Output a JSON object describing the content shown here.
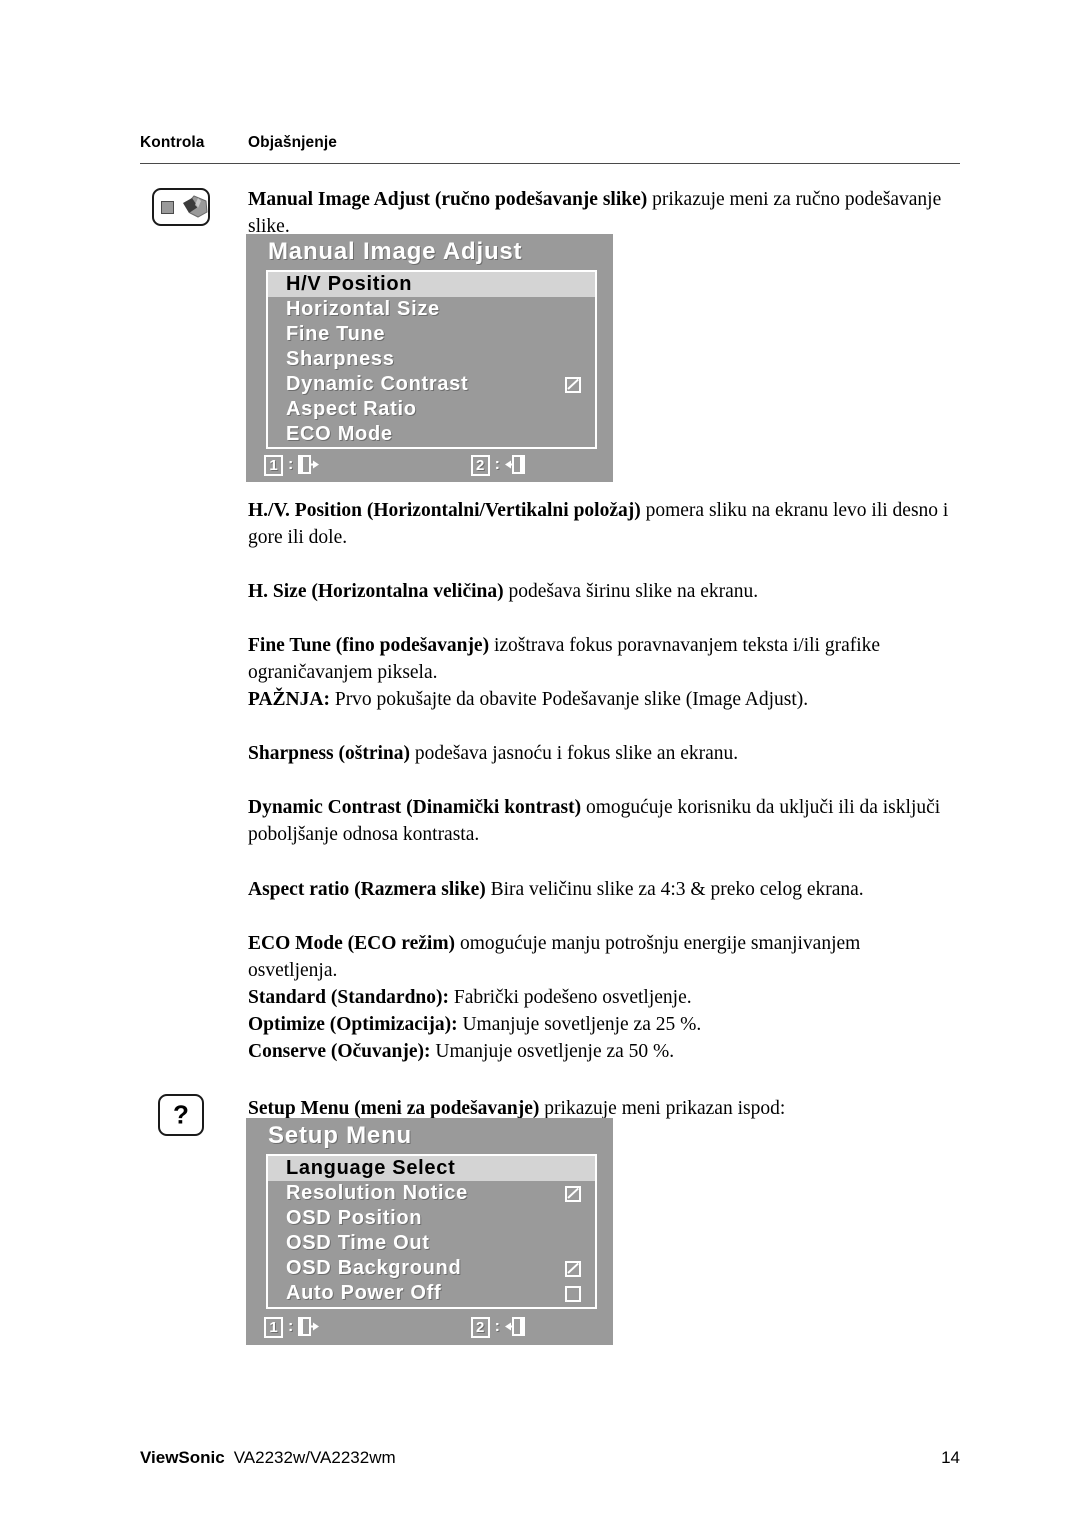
{
  "columns": {
    "control_header": "Kontrola",
    "explanation_header": "Objašnjenje"
  },
  "sections": {
    "manual_image_adjust": {
      "icon": "image-adjust-icon",
      "intro_bold": "Manual Image Adjust (ručno podešavanje slike)",
      "intro_rest": " prikazuje meni za ručno podešavanje slike.",
      "osd": {
        "title": "Manual Image Adjust",
        "rows": [
          {
            "label": "H/V Position",
            "selected": true,
            "checkbox": "none"
          },
          {
            "label": "Horizontal Size",
            "selected": false,
            "checkbox": "none"
          },
          {
            "label": "Fine Tune",
            "selected": false,
            "checkbox": "none"
          },
          {
            "label": "Sharpness",
            "selected": false,
            "checkbox": "none"
          },
          {
            "label": "Dynamic Contrast",
            "selected": false,
            "checkbox": "checked"
          },
          {
            "label": "Aspect Ratio",
            "selected": false,
            "checkbox": "none"
          },
          {
            "label": "ECO Mode",
            "selected": false,
            "checkbox": "none"
          }
        ],
        "footer": {
          "key1": "1",
          "sep1": ":",
          "icon1": "exit-right-icon",
          "key2": "2",
          "sep2": ":",
          "icon2": "exit-left-icon"
        }
      }
    },
    "setup_menu": {
      "icon": "question-mark-icon",
      "icon_glyph": "?",
      "intro_bold": "Setup Menu (meni za podešavanje)",
      "intro_rest": " prikazuje meni prikazan ispod:",
      "osd": {
        "title": "Setup Menu",
        "rows": [
          {
            "label": "Language Select",
            "selected": true,
            "checkbox": "none"
          },
          {
            "label": "Resolution Notice",
            "selected": false,
            "checkbox": "checked"
          },
          {
            "label": "OSD Position",
            "selected": false,
            "checkbox": "none"
          },
          {
            "label": "OSD Time Out",
            "selected": false,
            "checkbox": "none"
          },
          {
            "label": "OSD Background",
            "selected": false,
            "checkbox": "checked"
          },
          {
            "label": "Auto Power Off",
            "selected": false,
            "checkbox": "empty"
          }
        ],
        "footer": {
          "key1": "1",
          "sep1": ":",
          "icon1": "exit-right-icon",
          "key2": "2",
          "sep2": ":",
          "icon2": "exit-left-icon"
        }
      }
    }
  },
  "paragraphs": [
    {
      "id": "hv-position",
      "bold": "H./V. Position (Horizontalni/Vertikalni položaj)",
      "rest": " pomera sliku na ekranu levo ili desno i gore ili dole."
    },
    {
      "id": "h-size",
      "bold": "H. Size (Horizontalna veličina)",
      "rest": " podešava širinu slike na ekranu."
    },
    {
      "id": "fine-tune",
      "bold": "Fine Tune (fino podešavanje)",
      "rest": " izoštrava fokus poravnavanjem teksta i/ili grafike ograničavanjem piksela.",
      "note_bold": "PAŽNJA:",
      "note_rest": " Prvo pokušajte da obavite Podešavanje slike (Image Adjust)."
    },
    {
      "id": "sharpness",
      "bold": "Sharpness (oštrina)",
      "rest": " podešava jasnoću i fokus slike an ekranu."
    },
    {
      "id": "dynamic-contrast",
      "bold": "Dynamic Contrast (Dinamički kontrast)",
      "rest": " omogućuje korisniku da uključi ili da isključi poboljšanje odnosa kontrasta."
    },
    {
      "id": "aspect-ratio",
      "bold": "Aspect ratio (Razmera slike)",
      "rest": " Bira veličinu slike za 4:3 & preko celog ekrana."
    },
    {
      "id": "eco-mode",
      "bold": "ECO Mode (ECO režim)",
      "rest": " omogućuje manju potrošnju energije smanjivanjem osvetljenja.",
      "sub": [
        {
          "bold": "Standard (Standardno):",
          "rest": " Fabrički podešeno osvetljenje."
        },
        {
          "bold": "Optimize (Optimizacija):",
          "rest": " Umanjuje sovetljenje za 25 %."
        },
        {
          "bold": "Conserve (Očuvanje):",
          "rest": " Umanjuje osvetljenje za 50 %."
        }
      ]
    }
  ],
  "footer": {
    "brand": "ViewSonic",
    "model": "VA2232w/VA2232wm",
    "page_number": "14"
  },
  "colors": {
    "osd_background": "#9a9a9a",
    "osd_selected_row": "#d4d4d4",
    "text": "#000000",
    "rule": "#4a4a4a"
  }
}
